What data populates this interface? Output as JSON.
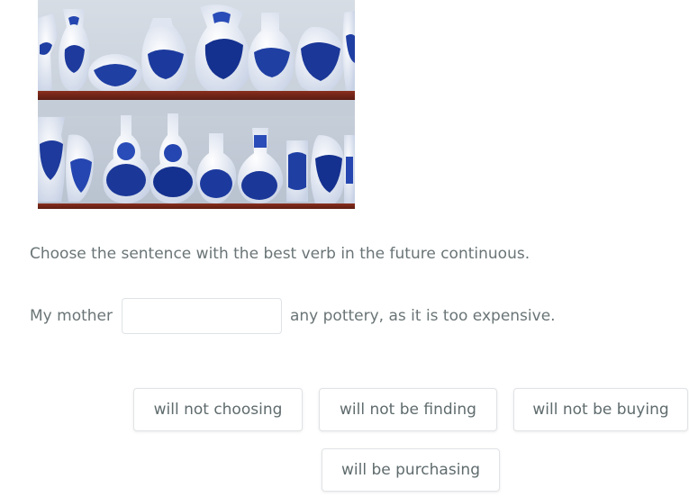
{
  "image": {
    "alt": "Shelves of blue and white Delft pottery vases"
  },
  "question": {
    "instruction": "Choose the sentence with the best verb in the future continuous.",
    "sentence_before": "My mother",
    "blank_value": "",
    "sentence_after": "any pottery, as it is too expensive."
  },
  "options": [
    "will not choosing",
    "will not be finding",
    "will not be buying",
    "will be purchasing"
  ]
}
